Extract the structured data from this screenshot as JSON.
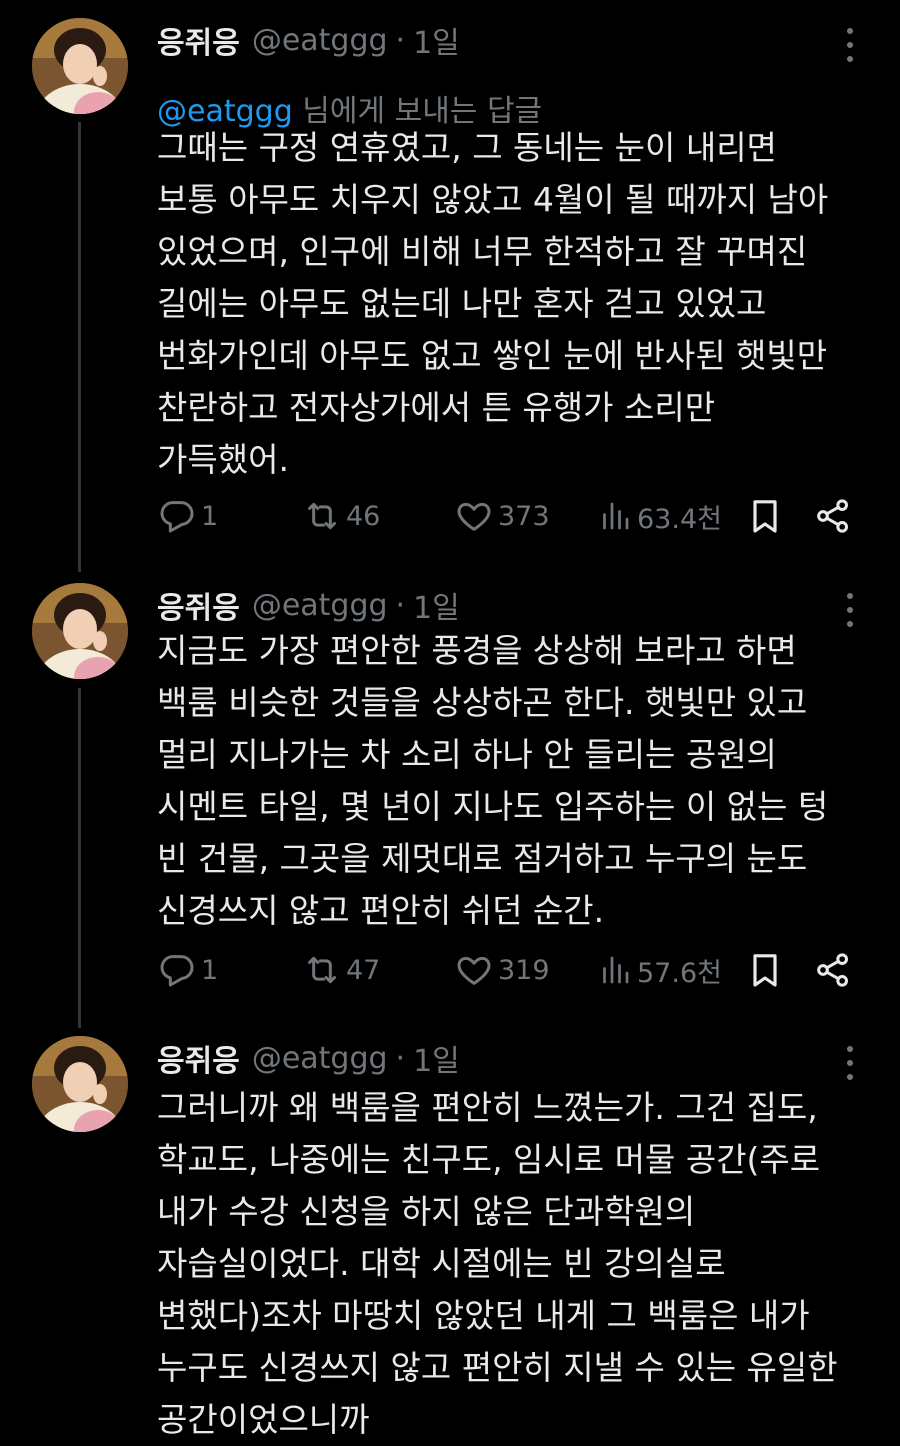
{
  "tweets": [
    {
      "author": {
        "name": "응쥐응",
        "handle": "@eatggg"
      },
      "separator": "·",
      "time": "1일",
      "reply_to": {
        "mention": "@eatggg",
        "suffix": " 님에게 보내는 답글"
      },
      "text": "그때는 구정 연휴였고, 그 동네는 눈이 내리면\n보통 아무도 치우지 않았고 4월이 될 때까지 남아\n있었으며, 인구에 비해 너무 한적하고 잘 꾸며진\n길에는 아무도 없는데 나만 혼자 걷고 있었고\n번화가인데 아무도 없고 쌓인 눈에 반사된 햇빛만\n찬란하고 전자상가에서 튼 유행가 소리만\n가득했어.",
      "stats": {
        "replies": "1",
        "reposts": "46",
        "likes": "373",
        "views": "63.4천"
      }
    },
    {
      "author": {
        "name": "응쥐응",
        "handle": "@eatggg"
      },
      "separator": "·",
      "time": "1일",
      "text": "지금도 가장 편안한 풍경을 상상해 보라고 하면\n백룸 비슷한 것들을 상상하곤 한다. 햇빛만 있고\n멀리 지나가는 차 소리 하나 안 들리는 공원의\n시멘트 타일, 몇 년이 지나도 입주하는 이 없는 텅\n빈 건물, 그곳을 제멋대로 점거하고 누구의 눈도\n신경쓰지 않고 편안히 쉬던 순간.",
      "stats": {
        "replies": "1",
        "reposts": "47",
        "likes": "319",
        "views": "57.6천"
      }
    },
    {
      "author": {
        "name": "응쥐응",
        "handle": "@eatggg"
      },
      "separator": "·",
      "time": "1일",
      "text": "그러니까 왜 백룸을 편안히 느꼈는가. 그건 집도,\n학교도, 나중에는 친구도, 임시로 머물 공간(주로\n내가 수강 신청을 하지 않은 단과학원의\n자습실이었다. 대학 시절에는 빈 강의실로\n변했다)조차 마땅치 않았던 내게 그 백룸은 내가\n누구도 신경쓰지 않고 편안히 지낼 수 있는 유일한\n공간이었으니까"
    }
  ],
  "icons": {
    "reply": "reply-icon",
    "repost": "repost-icon",
    "like": "heart-icon",
    "views": "views-icon",
    "bookmark": "bookmark-icon",
    "share": "share-icon",
    "more": "more-icon"
  },
  "colors": {
    "background": "#000000",
    "text": "#e7e9ea",
    "muted": "#71767b",
    "link": "#1d9bf0",
    "thread_line": "#333639"
  }
}
